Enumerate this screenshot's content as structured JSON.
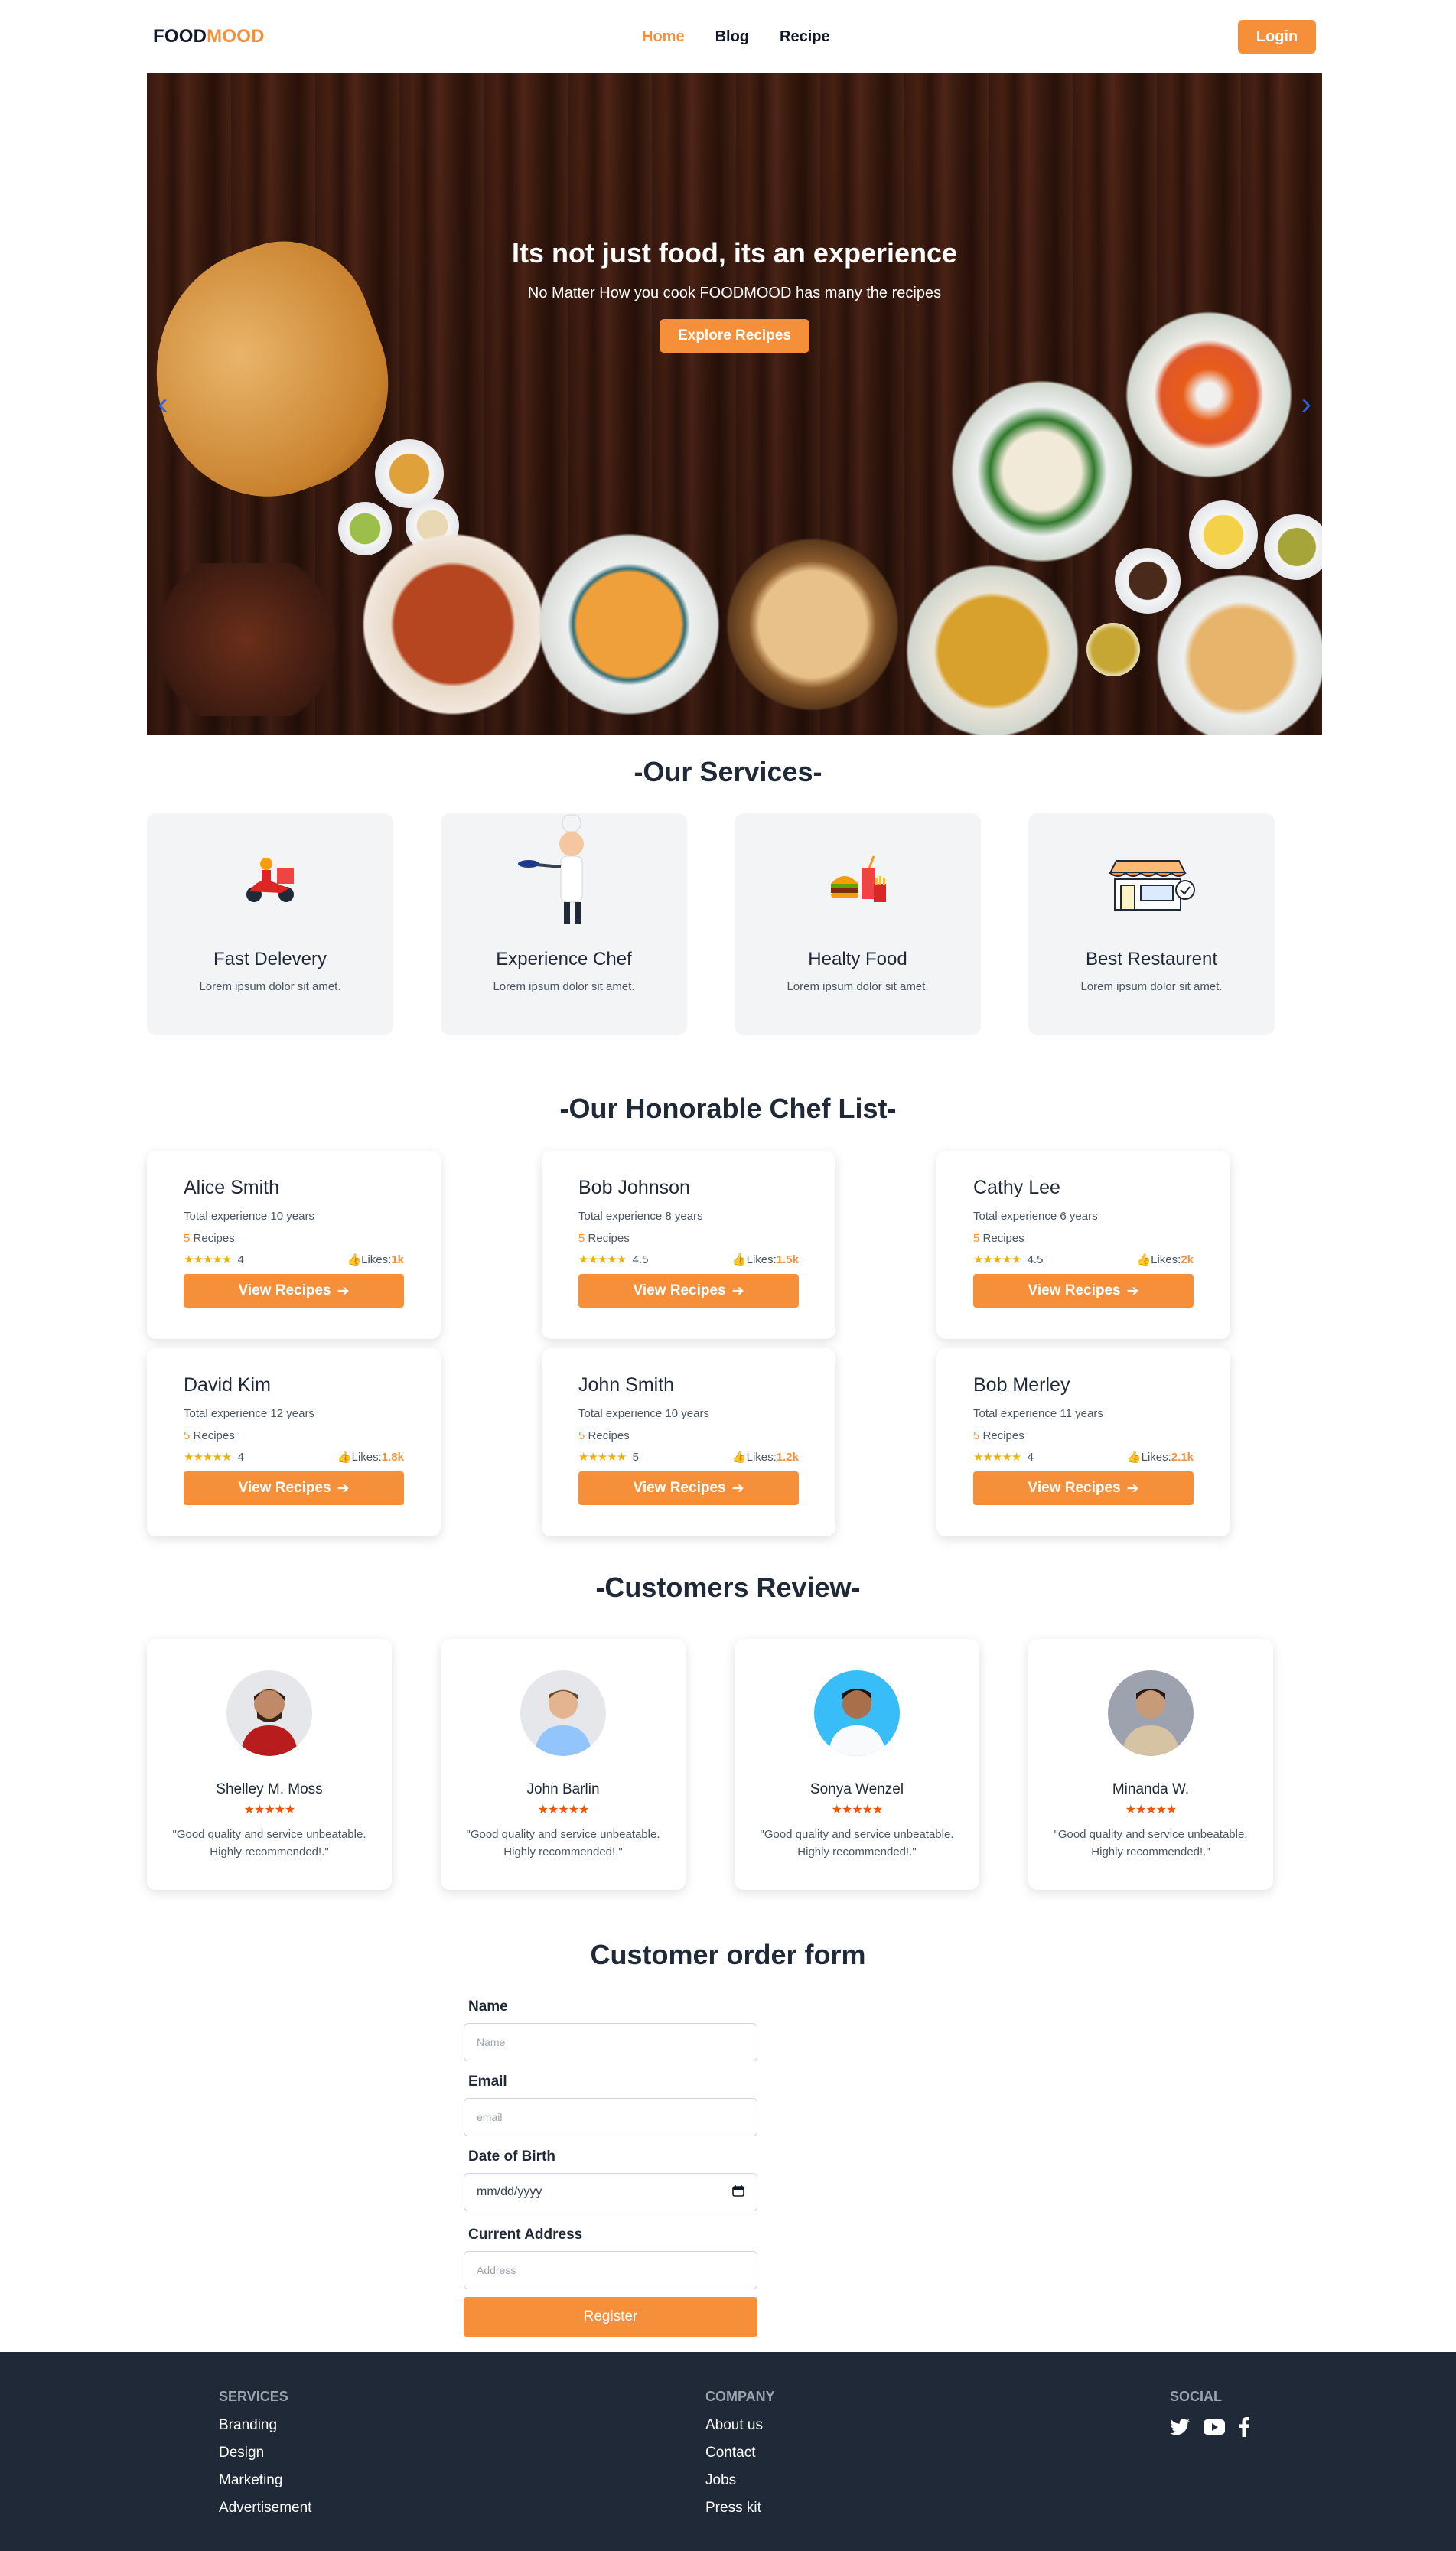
{
  "brand": {
    "part1": "FOOD",
    "part2": "MOOD"
  },
  "nav": {
    "links": [
      "Home",
      "Blog",
      "Recipe"
    ],
    "login": "Login"
  },
  "hero": {
    "title": "Its not just food, its an experience",
    "subtitle": "No Matter How you cook FOODMOOD has many the recipes",
    "button": "Explore Recipes",
    "prev": "‹",
    "next": "›"
  },
  "services": {
    "title": "-Our Services-",
    "items": [
      {
        "title": "Fast Delevery",
        "desc": "Lorem ipsum dolor sit amet.",
        "icon": "scooter-delivery-icon"
      },
      {
        "title": "Experience Chef",
        "desc": "Lorem ipsum dolor sit amet.",
        "icon": "chef-icon"
      },
      {
        "title": "Healty Food",
        "desc": "Lorem ipsum dolor sit amet.",
        "icon": "burger-combo-icon"
      },
      {
        "title": "Best Restaurent",
        "desc": "Lorem ipsum dolor sit amet.",
        "icon": "restaurant-icon"
      }
    ]
  },
  "chefs": {
    "title": "-Our Honorable Chef List-",
    "items": [
      {
        "name": "Alice Smith",
        "experience": "Total experience 10 years",
        "recipes_n": "5",
        "recipes_label": "Recipes",
        "stars": "★★★★★",
        "rating": "4",
        "likes_label": "Likes:",
        "likes": "1k",
        "button": "View Recipes"
      },
      {
        "name": "Bob Johnson",
        "experience": "Total experience 8 years",
        "recipes_n": "5",
        "recipes_label": "Recipes",
        "stars": "★★★★★",
        "rating": "4.5",
        "likes_label": "Likes:",
        "likes": "1.5k",
        "button": "View Recipes"
      },
      {
        "name": "Cathy Lee",
        "experience": "Total experience 6 years",
        "recipes_n": "5",
        "recipes_label": "Recipes",
        "stars": "★★★★★",
        "rating": "4.5",
        "likes_label": "Likes:",
        "likes": "2k",
        "button": "View Recipes"
      },
      {
        "name": "David Kim",
        "experience": "Total experience 12 years",
        "recipes_n": "5",
        "recipes_label": "Recipes",
        "stars": "★★★★★",
        "rating": "4",
        "likes_label": "Likes:",
        "likes": "1.8k",
        "button": "View Recipes"
      },
      {
        "name": "John Smith",
        "experience": "Total experience 10 years",
        "recipes_n": "5",
        "recipes_label": "Recipes",
        "stars": "★★★★★",
        "rating": "5",
        "likes_label": "Likes:",
        "likes": "1.2k",
        "button": "View Recipes"
      },
      {
        "name": "Bob Merley",
        "experience": "Total experience 11 years",
        "recipes_n": "5",
        "recipes_label": "Recipes",
        "stars": "★★★★★",
        "rating": "4",
        "likes_label": "Likes:",
        "likes": "2.1k",
        "button": "View Recipes"
      }
    ]
  },
  "reviews": {
    "title": "-Customers Review-",
    "items": [
      {
        "name": "Shelley M. Moss",
        "stars": "★★★★★",
        "text": "\"Good quality and service unbeatable. Highly recommended!.\"",
        "bg": "#e5e7eb",
        "shirt": "#b91c1c"
      },
      {
        "name": "John Barlin",
        "stars": "★★★★★",
        "text": "\"Good quality and service unbeatable. Highly recommended!.\"",
        "bg": "#e5e7eb",
        "shirt": "#93c5fd"
      },
      {
        "name": "Sonya Wenzel",
        "stars": "★★★★★",
        "text": "\"Good quality and service unbeatable. Highly recommended!.\"",
        "bg": "#38bdf8",
        "shirt": "#f9fafb"
      },
      {
        "name": "Minanda W.",
        "stars": "★★★★★",
        "text": "\"Good quality and service unbeatable. Highly recommended!.\"",
        "bg": "#9ca3af",
        "shirt": "#d6c3a3"
      }
    ]
  },
  "order_form": {
    "title": "Customer order form",
    "name_label": "Name",
    "name_placeholder": "Name",
    "email_label": "Email",
    "email_placeholder": "email",
    "dob_label": "Date of Birth",
    "dob_placeholder": "mm/dd/yyyy",
    "address_label": "Current Address",
    "address_placeholder": "Address",
    "submit": "Register"
  },
  "footer": {
    "services": {
      "heading": "SERVICES",
      "items": [
        "Branding",
        "Design",
        "Marketing",
        "Advertisement"
      ]
    },
    "company": {
      "heading": "COMPANY",
      "items": [
        "About us",
        "Contact",
        "Jobs",
        "Press kit"
      ]
    },
    "social": {
      "heading": "SOCIAL",
      "icons": [
        "twitter-icon",
        "youtube-icon",
        "facebook-icon"
      ]
    }
  },
  "colors": {
    "accent": "#f68f3a",
    "footer_bg": "#1f2937",
    "card_bg": "#f3f4f6"
  }
}
